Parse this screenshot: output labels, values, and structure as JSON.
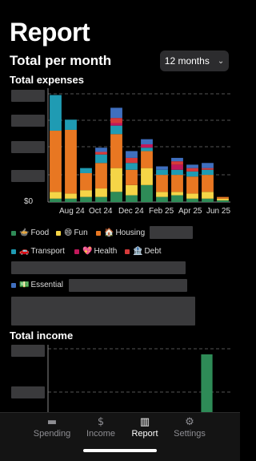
{
  "header": {
    "title": "Report",
    "subtitle": "Total per month"
  },
  "range_select": {
    "value": "12 months",
    "icon": "chevron-down-icon"
  },
  "expenses": {
    "section_title": "Total expenses"
  },
  "income": {
    "section_title": "Total income"
  },
  "legend": [
    {
      "label": "Food",
      "emoji": "🍲",
      "color": "#2e8b57"
    },
    {
      "label": "Fun",
      "emoji": "😄",
      "color": "#f5d547"
    },
    {
      "label": "Housing",
      "emoji": "🏠",
      "color": "#e87722"
    },
    {
      "label": "Transport",
      "emoji": "🚗",
      "color": "#1f9bb3"
    },
    {
      "label": "Health",
      "emoji": "💖",
      "color": "#c2185b"
    },
    {
      "label": "Debt",
      "emoji": "🏦",
      "color": "#d73a3a"
    },
    {
      "label": "Essential",
      "emoji": "💵",
      "color": "#3f6fbf"
    }
  ],
  "chart_data": [
    {
      "type": "bar",
      "stacked": true,
      "title": "Total expenses",
      "x_tick_labels": [
        "Aug 24",
        "Oct 24",
        "Dec 24",
        "Feb 25",
        "Apr 25",
        "Jun 25"
      ],
      "y_tick_labels": [
        "$0"
      ],
      "grid": true,
      "series_order": [
        "Food",
        "Fun",
        "Housing",
        "Transport",
        "Health",
        "Debt",
        "Essential"
      ],
      "months": [
        {
          "Food": 4,
          "Fun": 8,
          "Housing": 72,
          "Transport": 42,
          "Health": 0,
          "Debt": 0,
          "Essential": 0
        },
        {
          "Food": 4,
          "Fun": 6,
          "Housing": 75,
          "Transport": 12,
          "Health": 0,
          "Debt": 0,
          "Essential": 0
        },
        {
          "Food": 6,
          "Fun": 8,
          "Housing": 20,
          "Transport": 6,
          "Health": 0,
          "Debt": 0,
          "Essential": 0
        },
        {
          "Food": 6,
          "Fun": 10,
          "Housing": 30,
          "Transport": 10,
          "Health": 0,
          "Debt": 3,
          "Essential": 5
        },
        {
          "Food": 12,
          "Fun": 28,
          "Housing": 40,
          "Transport": 10,
          "Health": 3,
          "Debt": 6,
          "Essential": 12
        },
        {
          "Food": 8,
          "Fun": 12,
          "Housing": 18,
          "Transport": 8,
          "Health": 0,
          "Debt": 6,
          "Essential": 8
        },
        {
          "Food": 20,
          "Fun": 20,
          "Housing": 20,
          "Transport": 4,
          "Health": 4,
          "Debt": 0,
          "Essential": 6
        },
        {
          "Food": 6,
          "Fun": 6,
          "Housing": 20,
          "Transport": 6,
          "Health": 0,
          "Debt": 0,
          "Essential": 4
        },
        {
          "Food": 8,
          "Fun": 4,
          "Housing": 20,
          "Transport": 6,
          "Health": 6,
          "Debt": 4,
          "Essential": 4
        },
        {
          "Food": 4,
          "Fun": 6,
          "Housing": 20,
          "Transport": 6,
          "Health": 0,
          "Debt": 4,
          "Essential": 4
        },
        {
          "Food": 4,
          "Fun": 8,
          "Housing": 20,
          "Transport": 6,
          "Health": 0,
          "Debt": 2,
          "Essential": 6
        },
        {
          "Food": 2,
          "Fun": 2,
          "Housing": 2,
          "Transport": 0,
          "Health": 0,
          "Debt": 0,
          "Essential": 0
        }
      ]
    },
    {
      "type": "bar",
      "title": "Total income",
      "values": [
        0,
        0,
        0,
        0,
        0,
        0,
        0,
        0,
        0,
        0,
        0,
        80
      ],
      "color": "#2e8b57"
    }
  ],
  "tabs": [
    {
      "label": "Spending",
      "icon": "camera-icon",
      "glyph": "▬",
      "active": false
    },
    {
      "label": "Income",
      "icon": "dollar-icon",
      "glyph": "$",
      "active": false
    },
    {
      "label": "Report",
      "icon": "bar-chart-icon",
      "glyph": "▥",
      "active": true
    },
    {
      "label": "Settings",
      "icon": "gear-icon",
      "glyph": "⚙",
      "active": false
    }
  ]
}
